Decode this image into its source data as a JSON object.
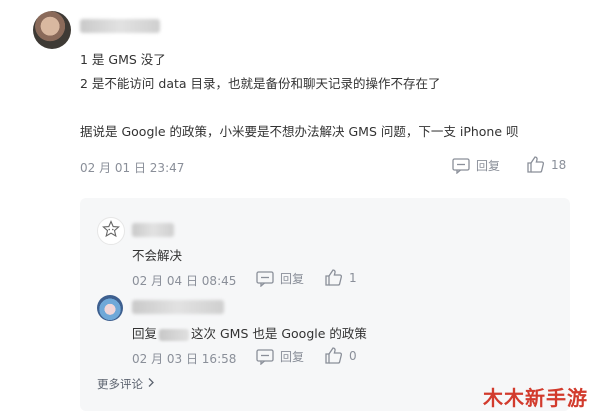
{
  "comment": {
    "lines": [
      "1 是 GMS 没了",
      "2 是不能访问 data 目录，也就是备份和聊天记录的操作不存在了",
      "据说是 Google 的政策，小米要是不想办法解决 GMS 问题，下一支 iPhone 呗"
    ],
    "timestamp": "02 月 01 日 23:47",
    "reply_label": "回复",
    "like_count": "18"
  },
  "replies": [
    {
      "text": "不会解决",
      "timestamp": "02 月 04 日 08:45",
      "reply_label": "回复",
      "like_count": "1"
    },
    {
      "prefix": "回复",
      "text": "这次 GMS 也是 Google 的政策",
      "timestamp": "02 月 03 日 16:58",
      "reply_label": "回复",
      "like_count": "0"
    }
  ],
  "more_comments_label": "更多评论",
  "watermark_text": "木木新手游",
  "colors": {
    "meta": "#8a8f99",
    "reply_bg": "#f6f7f8",
    "watermark": "#d23b2d"
  },
  "icons": [
    "reply-icon",
    "thumbs-up-icon",
    "chevron-right-icon",
    "star-avatar-icon"
  ]
}
